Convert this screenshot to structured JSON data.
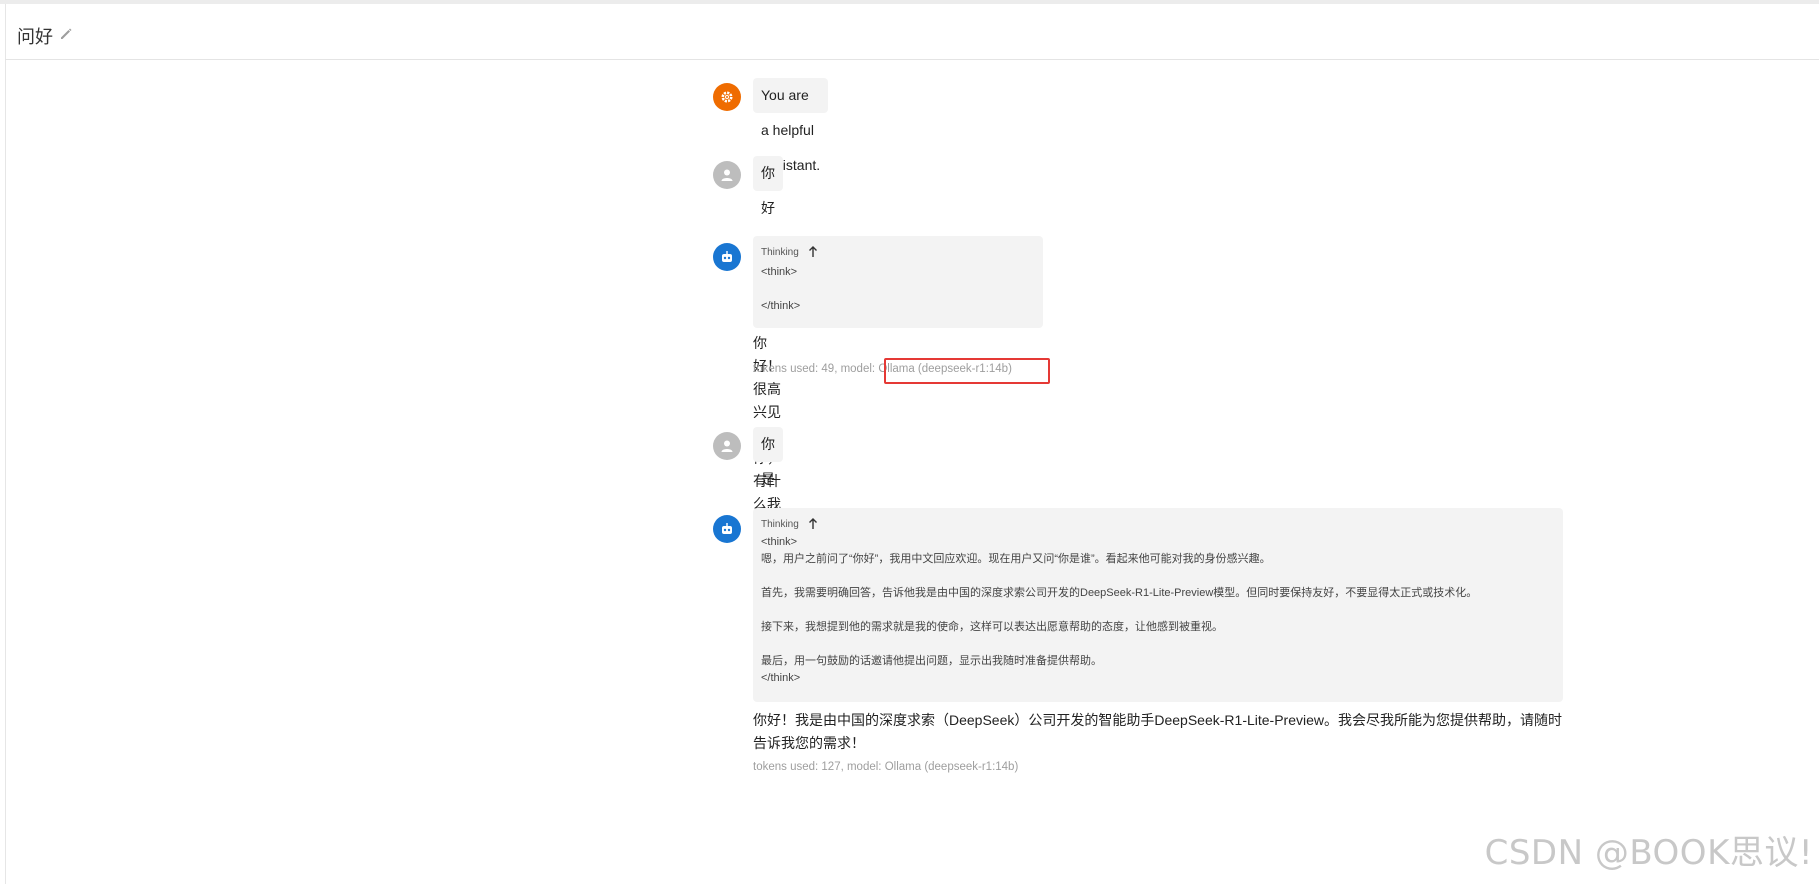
{
  "header": {
    "title": "问好",
    "edit_icon": "pencil-icon"
  },
  "messages": {
    "system": {
      "avatar_icon": "gear-icon",
      "text": "You are a helpful assistant."
    },
    "user1": {
      "avatar_icon": "person-icon",
      "text": "你好"
    },
    "bot1": {
      "avatar_icon": "robot-icon",
      "thinking_label": "Thinking",
      "thinking_toggle_icon": "arrow-up-icon",
      "think_open": "<think>",
      "think_close": "</think>",
      "reply": "你好！很高兴见到你，有什么我可以帮忙的吗？",
      "meta_prefix": "tokens used: 49, model:",
      "meta_model": "Ollama (deepseek-r1:14b)"
    },
    "user2": {
      "avatar_icon": "person-icon",
      "text": "你是谁"
    },
    "bot2": {
      "avatar_icon": "robot-icon",
      "thinking_label": "Thinking",
      "thinking_toggle_icon": "arrow-up-icon",
      "think_open": "<think>",
      "think_lines": [
        "嗯，用户之前问了“你好”，我用中文回应欢迎。现在用户又问“你是谁”。看起来他可能对我的身份感兴趣。",
        "首先，我需要明确回答，告诉他我是由中国的深度求索公司开发的DeepSeek-R1-Lite-Preview模型。但同时要保持友好，不要显得太正式或技术化。",
        "接下来，我想提到他的需求就是我的使命，这样可以表达出愿意帮助的态度，让他感到被重视。",
        "最后，用一句鼓励的话邀请他提出问题，显示出我随时准备提供帮助。"
      ],
      "think_close": "</think>",
      "reply_line1": "你好！我是由中国的深度求索（DeepSeek）公司开发的智能助手DeepSeek-R1-Lite-Preview。我会尽我所能为您提供帮助，请随时",
      "reply_line2": "告诉我您的需求！",
      "meta": "tokens used: 127, model: Ollama (deepseek-r1:14b)"
    }
  },
  "highlight_color": "#e53935",
  "watermark": "CSDN @BOOK思议!"
}
